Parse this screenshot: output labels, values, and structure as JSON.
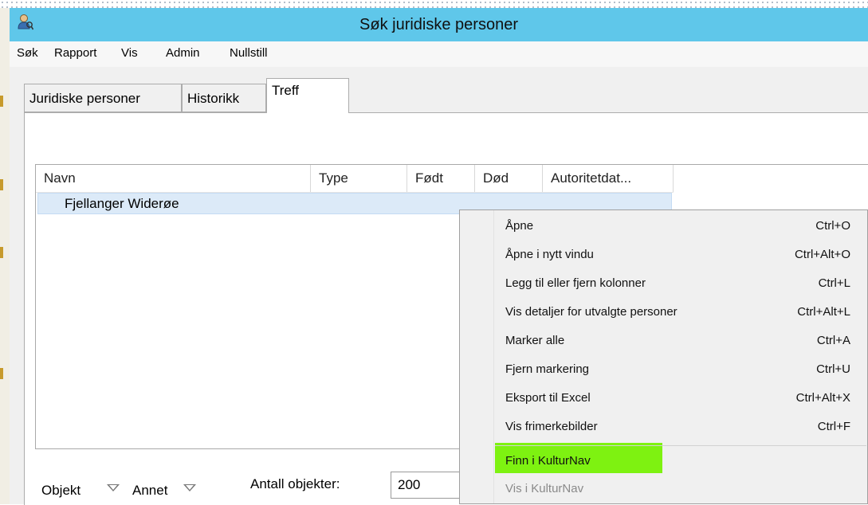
{
  "window": {
    "title": "Søk juridiske personer",
    "icon": "user-search-icon"
  },
  "menubar": {
    "items": [
      "Søk",
      "Rapport",
      "Vis",
      "Admin",
      "Nullstill"
    ]
  },
  "tabs": [
    {
      "label": "Juridiske personer",
      "active": false
    },
    {
      "label": "Historikk",
      "active": false
    },
    {
      "label": "Treff",
      "active": true
    }
  ],
  "table": {
    "columns": [
      "Navn",
      "Type",
      "Født",
      "Død",
      "Autoritetdat..."
    ],
    "rows": [
      {
        "navn": "Fjellanger Widerøe",
        "type": "",
        "fodt": "",
        "dod": "",
        "autoritet": ""
      }
    ]
  },
  "bottom": {
    "objekt_label": "Objekt",
    "annet_label": "Annet",
    "count_label": "Antall objekter:",
    "count_value": "200"
  },
  "context_menu": {
    "items": [
      {
        "label": "Åpne",
        "shortcut": "Ctrl+O"
      },
      {
        "label": "Åpne i nytt vindu",
        "shortcut": "Ctrl+Alt+O"
      },
      {
        "label": "Legg til eller fjern kolonner",
        "shortcut": "Ctrl+L"
      },
      {
        "label": "Vis detaljer for utvalgte personer",
        "shortcut": "Ctrl+Alt+L"
      },
      {
        "label": "Marker alle",
        "shortcut": "Ctrl+A"
      },
      {
        "label": "Fjern markering",
        "shortcut": "Ctrl+U"
      },
      {
        "label": "Eksport til Excel",
        "shortcut": "Ctrl+Alt+X"
      },
      {
        "label": "Vis frimerkebilder",
        "shortcut": "Ctrl+F"
      },
      {
        "label": "Finn i KulturNav",
        "shortcut": "",
        "highlighted": true
      },
      {
        "label": "Vis i KulturNav",
        "shortcut": "",
        "disabled": true
      }
    ]
  },
  "colors": {
    "titlebar": "#5fc7ea",
    "highlight": "#7ef211",
    "row_selected": "#dceaf8"
  }
}
